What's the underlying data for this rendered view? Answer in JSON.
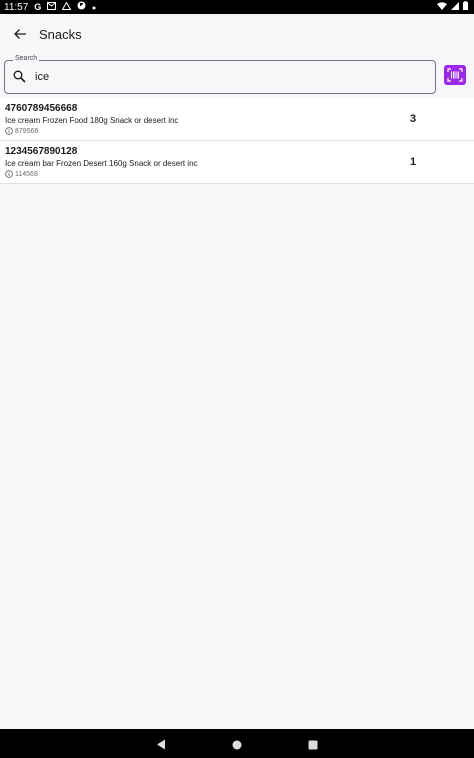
{
  "status_bar": {
    "time": "11:57",
    "icons": [
      "google-icon",
      "gmail-icon",
      "drive-icon",
      "flipboard-icon",
      "dot-icon"
    ],
    "right_icons": [
      "wifi-icon",
      "signal-icon",
      "battery-icon"
    ]
  },
  "app_bar": {
    "back_icon": "arrow-back-icon",
    "title": "Snacks"
  },
  "search": {
    "label": "Search",
    "value": "ice",
    "icon": "search-icon",
    "scan_icon": "barcode-scan-icon"
  },
  "items": [
    {
      "barcode": "4760789456668",
      "description": "Ice cream Frozen Food 180g Snack or desert inc",
      "code": "879566",
      "quantity": "3"
    },
    {
      "barcode": "1234567890128",
      "description": "Ice cream bar Frozen Desert 160g Snack or desert inc",
      "code": "114568",
      "quantity": "1"
    }
  ],
  "nav_bar": {
    "icons": [
      "back-triangle-icon",
      "home-circle-icon",
      "recents-square-icon"
    ]
  },
  "colors": {
    "accent": "#9c27f0",
    "background": "#f7f7f9",
    "card": "#ffffff"
  }
}
